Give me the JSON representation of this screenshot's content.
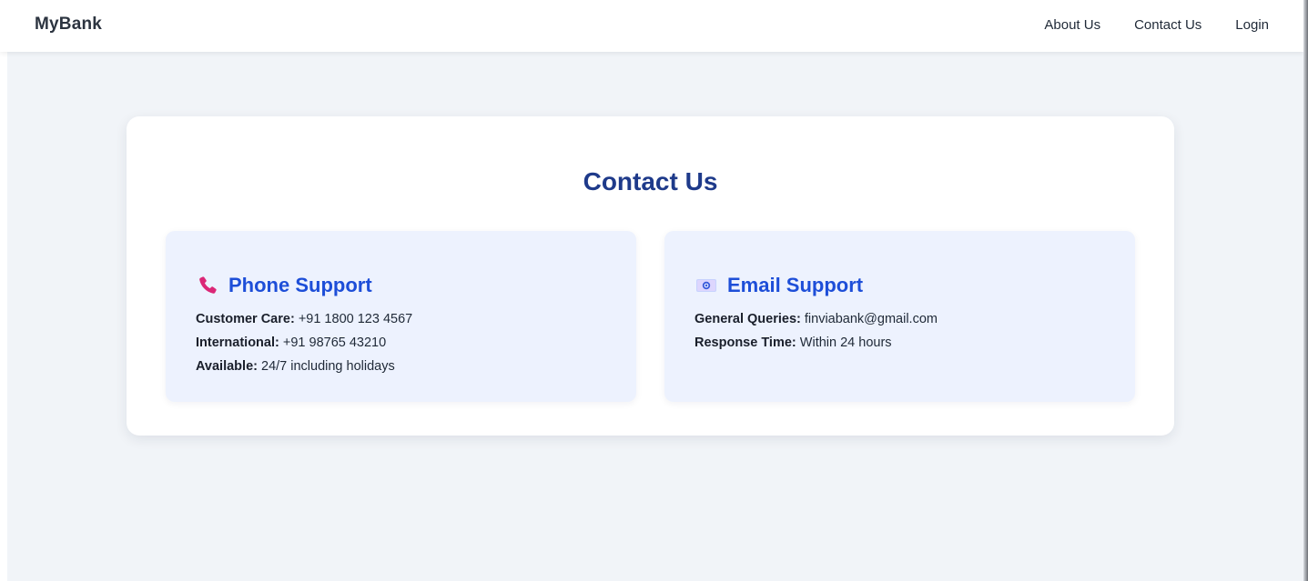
{
  "navbar": {
    "brand": "MyBank",
    "links": [
      "About Us",
      "Contact Us",
      "Login"
    ]
  },
  "page": {
    "title": "Contact Us"
  },
  "phone_support": {
    "icon": "phone-icon",
    "title": "Phone Support",
    "rows": [
      {
        "label": "Customer Care:",
        "value": "+91 1800 123 4567"
      },
      {
        "label": "International:",
        "value": "+91 98765 43210"
      },
      {
        "label": "Available:",
        "value": "24/7 including holidays"
      }
    ]
  },
  "email_support": {
    "icon": "email-icon",
    "title": "Email Support",
    "rows": [
      {
        "label": "General Queries:",
        "value": "finviabank@gmail.com"
      },
      {
        "label": "Response Time:",
        "value": "Within 24 hours"
      }
    ]
  },
  "colors": {
    "background": "#f1f4f8",
    "title": "#1e3a8a",
    "heading": "#1d4ed8",
    "panel": "#edf2fe",
    "phone_icon": "#db2777"
  }
}
